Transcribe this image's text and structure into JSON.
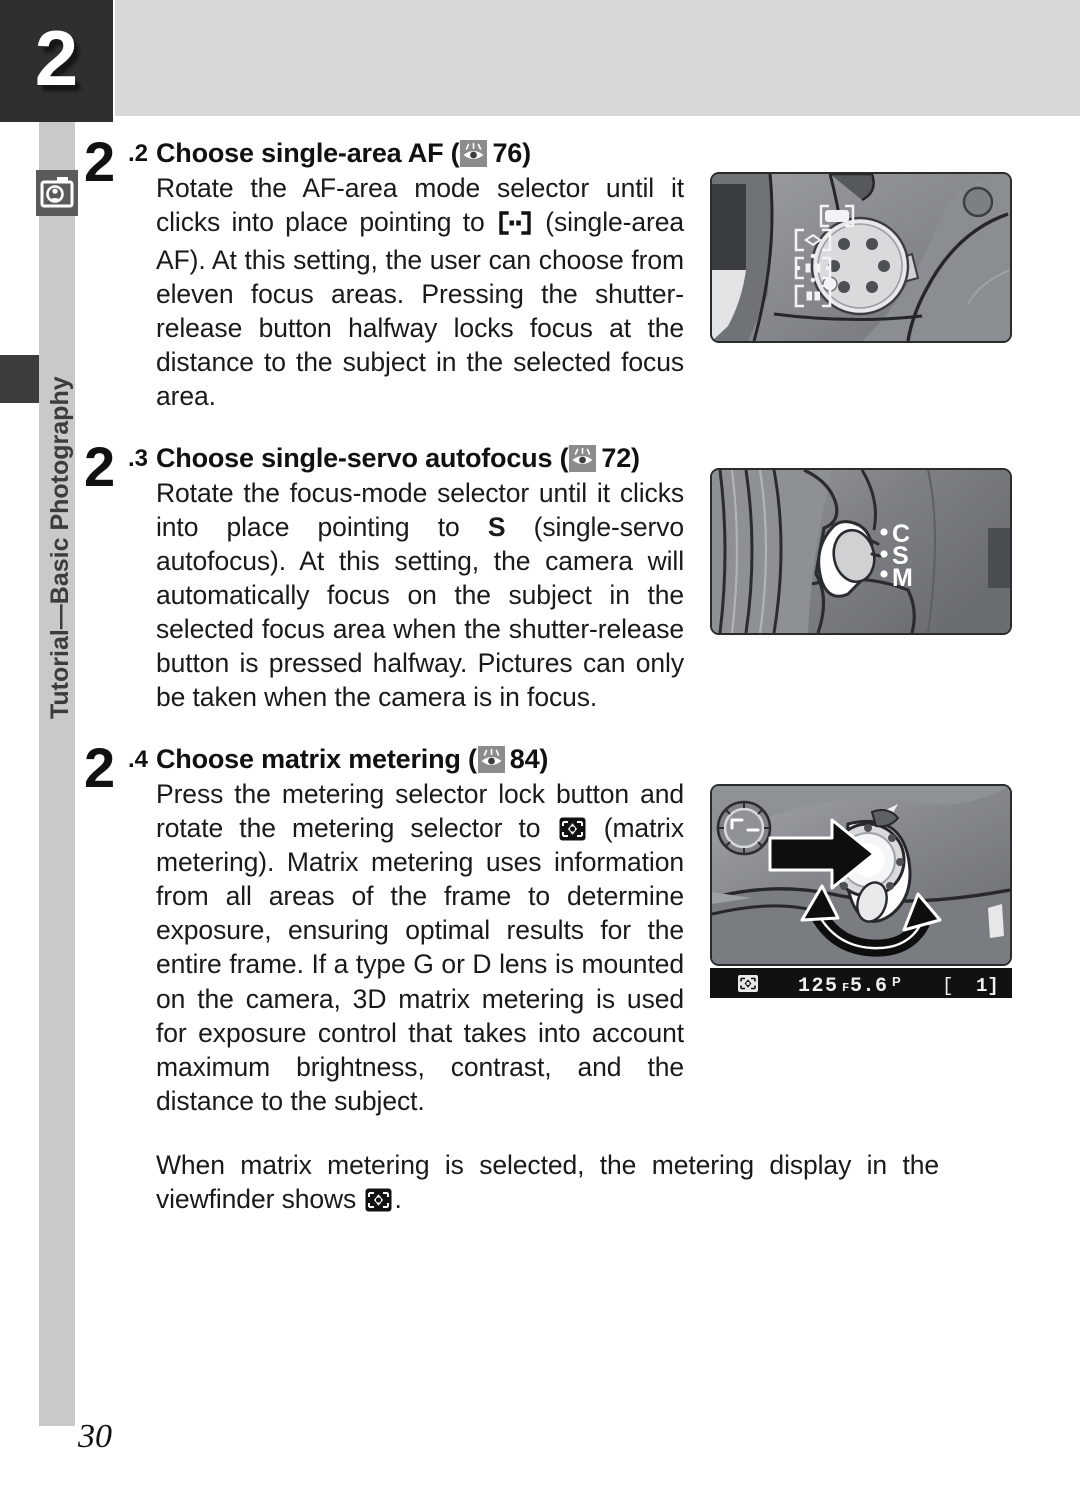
{
  "header": {
    "chapter_number": "2",
    "band_color": "#d8d8d8",
    "tab_color": "#2f2f2f"
  },
  "sidebar": {
    "label": "Tutorial—Basic Photography",
    "icon": "camera-person-icon",
    "rail_color": "#c9c9c9"
  },
  "steps": [
    {
      "num": "2",
      "sub": ".2",
      "heading_before": "Choose single-area AF (",
      "heading_page_ref": "76",
      "heading_after": ")",
      "body_part1": "Rotate the AF-area mode selector until it clicks into place pointing to ",
      "body_symbol": "single-area-af-bracket-icon",
      "body_part2": " (single-area AF).  At this setting, the user can choose from eleven focus areas.  Pressing the shutter-release button halfway locks focus at the distance to the subject in the selected focus area."
    },
    {
      "num": "2",
      "sub": ".3",
      "heading_before": "Choose single-servo autofocus (",
      "heading_page_ref": "72",
      "heading_after": ")",
      "body_part1": "Rotate the focus-mode selector until it clicks into place pointing to ",
      "body_symbol": "S",
      "body_part2": " (single-servo autofocus).  At this setting, the camera will automatically focus on the subject in the selected focus area when the shutter-release button is pressed halfway.  Pictures can only be taken when the camera is in focus."
    },
    {
      "num": "2",
      "sub": ".4",
      "heading_before": "Choose matrix metering (",
      "heading_page_ref": "84",
      "heading_after": ")",
      "body_part1": "Press the metering selector lock button and rotate the metering selector to ",
      "body_symbol": "matrix-metering-icon",
      "body_part2": " (matrix metering).  Matrix metering uses information from all areas of the frame to determine exposure, ensuring optimal results for the entire frame.  If a type G or D lens is mounted on the camera, 3D matrix metering is used for exposure control that takes into account maximum brightness, contrast, and the distance to the subject."
    }
  ],
  "note": {
    "part1": "When matrix metering is selected, the metering display in the viewfinder shows ",
    "symbol": "matrix-metering-icon",
    "part2": "."
  },
  "figures": {
    "af_area_selector": {
      "name": "AF-area mode selector dial",
      "mode_icons": [
        "closest-subject-rect",
        "dynamic-area-diamond",
        "group-dynamic-dotted",
        "single-area-bracket"
      ]
    },
    "focus_mode_selector": {
      "name": "Focus-mode selector",
      "labels": [
        "C",
        "S",
        "M"
      ]
    },
    "metering_selector": {
      "name": "Metering selector and lock button"
    }
  },
  "viewfinder": {
    "metering_icon": "matrix-metering-icon",
    "shutter_speed": "125",
    "aperture_prefix": "F",
    "aperture": "5.6",
    "mode": "P",
    "frame_counter": "1"
  },
  "page_number": "30"
}
